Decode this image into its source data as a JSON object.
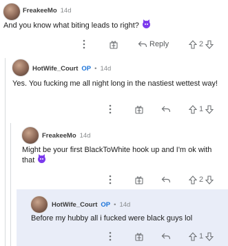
{
  "thread": [
    {
      "user": "FreakeeMo",
      "op_badge": "",
      "time": "14d",
      "body": "And you know what biting leads to right?",
      "has_emoji": true,
      "vote_count": "2",
      "reply_label": "Reply"
    },
    {
      "user": "HotWife_Court",
      "op_badge": "OP",
      "dot": "•",
      "time": "14d",
      "body": "Yes. You fucking me all night long in the nastiest wettest way!",
      "has_emoji": false,
      "vote_count": "1"
    },
    {
      "user": "FreakeeMo",
      "op_badge": "",
      "time": "14d",
      "body": "Might be your first BlackToWhite hook up and I'm ok with that",
      "has_emoji": true,
      "vote_count": "2"
    },
    {
      "user": "HotWife_Court",
      "op_badge": "OP",
      "dot": "•",
      "time": "14d",
      "body": "Before my hubby all i fucked were black guys lol",
      "has_emoji": false,
      "vote_count": "1"
    }
  ],
  "colors": {
    "accent_op": "#1a73d9",
    "highlight_bg": "#e9edf8",
    "emoji": "#7c3aed"
  },
  "icons": [
    "more-options-icon",
    "gift-award-icon",
    "reply-arrow-icon",
    "upvote-icon",
    "downvote-icon",
    "devil-emoji-icon"
  ]
}
